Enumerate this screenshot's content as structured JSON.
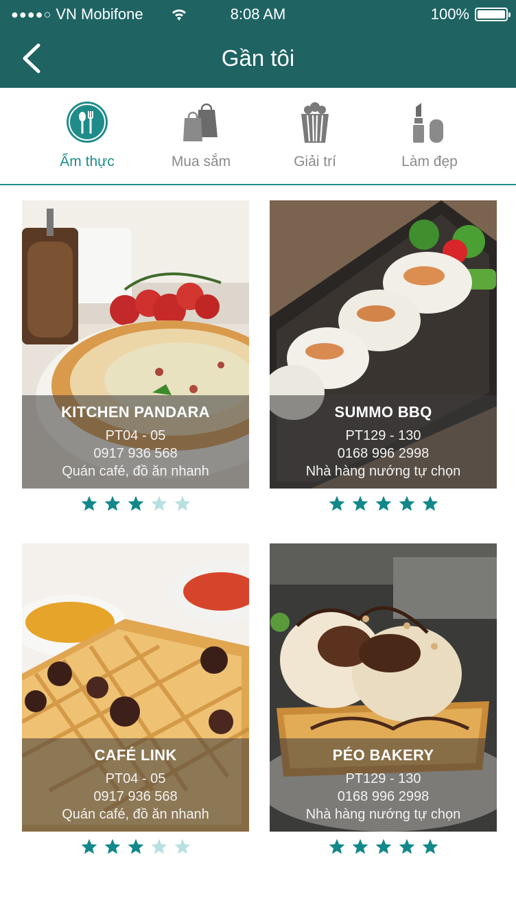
{
  "status_bar": {
    "signal": "●●●●○",
    "carrier": "VN Mobifone",
    "time": "8:08 AM",
    "battery": "100%"
  },
  "header": {
    "title": "Gần tôi",
    "back_icon": "chevron-left-icon"
  },
  "categories": [
    {
      "label": "Ẩm thực",
      "icon": "fork-spoon-icon",
      "active": true
    },
    {
      "label": "Mua sắm",
      "icon": "shopping-bags-icon",
      "active": false
    },
    {
      "label": "Giải trí",
      "icon": "popcorn-icon",
      "active": false
    },
    {
      "label": "Làm đẹp",
      "icon": "lipstick-icon",
      "active": false
    }
  ],
  "places": [
    {
      "name": "KITCHEN PANDARA",
      "location": "PT04 - 05",
      "phone": "0917 936 568",
      "type": "Quán café, đồ ăn nhanh",
      "rating": 3,
      "photo": "pizza"
    },
    {
      "name": "SUMMO BBQ",
      "location": "PT129 - 130",
      "phone": "0168 996 2998",
      "type": "Nhà hàng nướng tự chọn",
      "rating": 5,
      "photo": "squid"
    },
    {
      "name": "CAFÉ LINK",
      "location": "PT04 - 05",
      "phone": "0917 936 568",
      "type": "Quán café, đồ ăn nhanh",
      "rating": 3,
      "photo": "waffle"
    },
    {
      "name": "PÉO BAKERY",
      "location": "PT129 - 130",
      "phone": "0168 996 2998",
      "type": "Nhà hàng nướng tự chọn",
      "rating": 5,
      "photo": "dessert"
    }
  ],
  "colors": {
    "brand": "#1f6363",
    "accent": "#1f8c8a",
    "star_filled": "#12888a",
    "star_empty": "#b8e0e0"
  }
}
